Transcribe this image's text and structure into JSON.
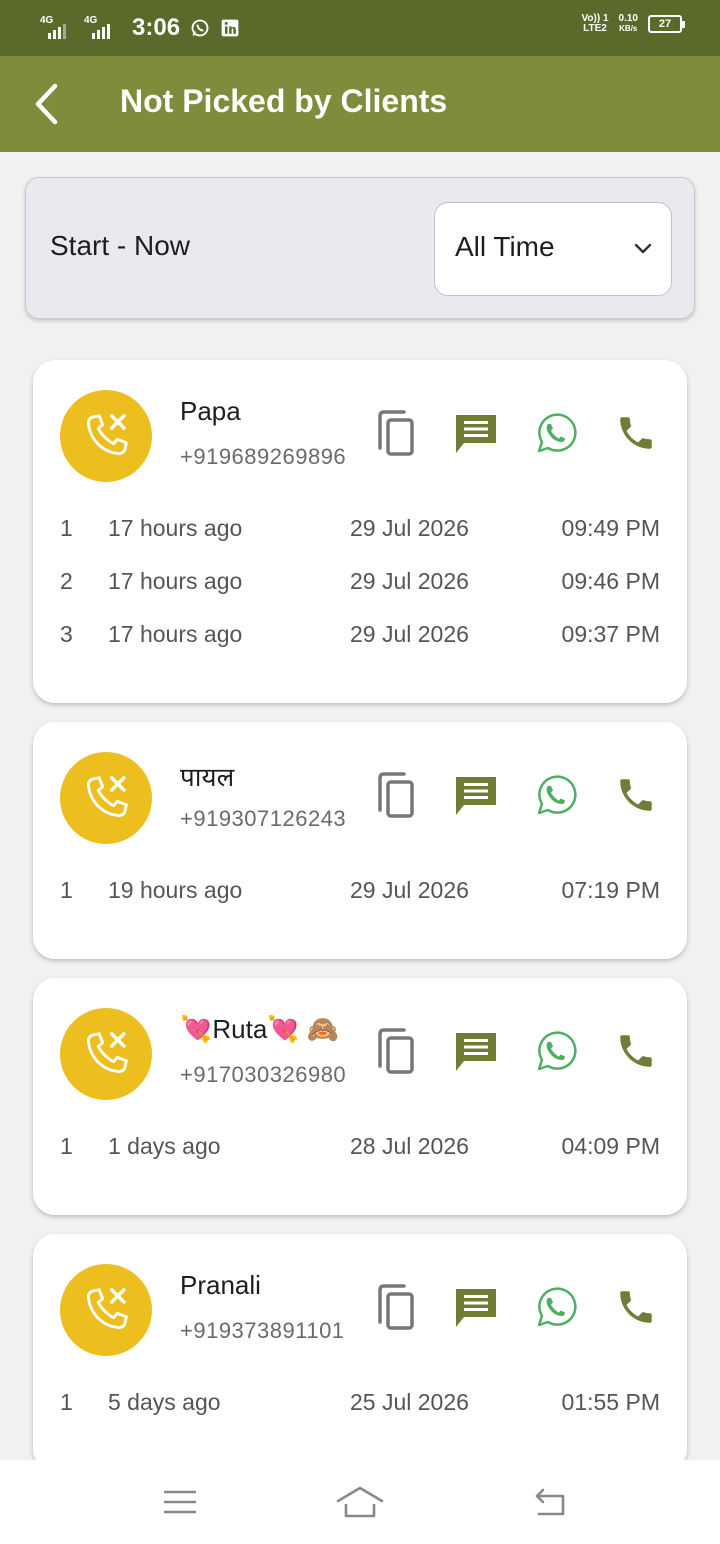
{
  "status_bar": {
    "network_1": "4G",
    "network_2": "4G",
    "time": "3:06",
    "volte_line_1": "Vo)) 1",
    "volte_line_2": "LTE2",
    "speed_value": "0.10",
    "speed_unit": "KB/s",
    "battery": "27"
  },
  "header": {
    "title": "Not Picked by Clients"
  },
  "filter": {
    "range_label": "Start - Now",
    "period_selected": "All Time"
  },
  "contacts": [
    {
      "name": "Papa",
      "phone": "+919689269896",
      "calls": [
        {
          "index": "1",
          "ago": "17 hours ago",
          "date": "29 Jul 2026",
          "time": "09:49 PM"
        },
        {
          "index": "2",
          "ago": "17 hours ago",
          "date": "29 Jul 2026",
          "time": "09:46 PM"
        },
        {
          "index": "3",
          "ago": "17 hours ago",
          "date": "29 Jul 2026",
          "time": "09:37 PM"
        }
      ]
    },
    {
      "name": "पायल",
      "phone": "+919307126243",
      "calls": [
        {
          "index": "1",
          "ago": "19 hours ago",
          "date": "29 Jul 2026",
          "time": "07:19 PM"
        }
      ]
    },
    {
      "name": "💘Ruta💘 🙈",
      "phone": "+917030326980",
      "calls": [
        {
          "index": "1",
          "ago": "1 days ago",
          "date": "28 Jul 2026",
          "time": "04:09 PM"
        }
      ]
    },
    {
      "name": "Pranali",
      "phone": "+919373891101",
      "calls": [
        {
          "index": "1",
          "ago": "5 days ago",
          "date": "25 Jul 2026",
          "time": "01:55 PM"
        }
      ]
    }
  ],
  "icons": {
    "back": "chevron-left-icon",
    "missed_call": "missed-call-icon",
    "copy": "copy-icon",
    "sms": "message-icon",
    "whatsapp": "whatsapp-icon",
    "call": "phone-icon",
    "menu": "menu-icon",
    "home": "home-icon",
    "return": "back-icon"
  },
  "colors": {
    "status_bar": "#5a6a2a",
    "app_bar": "#7e8c3c",
    "accent": "#6f7d35",
    "avatar": "#ecbe1e",
    "whatsapp": "#4caf63"
  }
}
